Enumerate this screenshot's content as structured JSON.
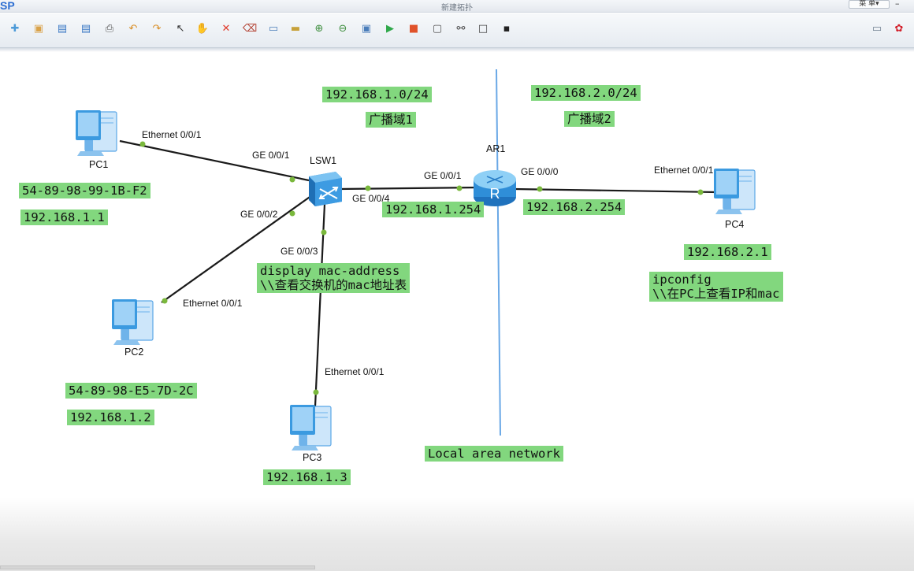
{
  "window": {
    "app_logo": "SP",
    "title": "新建拓扑",
    "menu_button": "菜 单▾",
    "minimize": "–"
  },
  "toolbar": {
    "buttons": [
      {
        "name": "new-topology-icon",
        "glyph": "✚",
        "color": "#4c9ad8"
      },
      {
        "name": "open-icon",
        "glyph": "▣",
        "color": "#d9a24a"
      },
      {
        "name": "save-icon",
        "glyph": "▤",
        "color": "#3a78c4"
      },
      {
        "name": "save-as-icon",
        "glyph": "▤",
        "color": "#3a78c4"
      },
      {
        "name": "print-icon",
        "glyph": "⎙",
        "color": "#555555"
      },
      {
        "name": "undo-icon",
        "glyph": "↶",
        "color": "#d9902a"
      },
      {
        "name": "redo-icon",
        "glyph": "↷",
        "color": "#d9902a"
      },
      {
        "name": "pointer-icon",
        "glyph": "↖",
        "color": "#333333"
      },
      {
        "name": "hand-icon",
        "glyph": "✋",
        "color": "#d49a3a"
      },
      {
        "name": "delete-icon",
        "glyph": "✕",
        "color": "#e03a2a"
      },
      {
        "name": "delete-link-icon",
        "glyph": "⌫",
        "color": "#b03a2a"
      },
      {
        "name": "text-note-icon",
        "glyph": "▭",
        "color": "#4a7dba"
      },
      {
        "name": "rectangle-icon",
        "glyph": "▬",
        "color": "#c7a13a"
      },
      {
        "name": "zoom-in-icon",
        "glyph": "⊕",
        "color": "#3f8f3f"
      },
      {
        "name": "zoom-out-icon",
        "glyph": "⊖",
        "color": "#3f8f3f"
      },
      {
        "name": "fit-view-icon",
        "glyph": "▣",
        "color": "#4a7dba"
      },
      {
        "name": "start-all-icon",
        "glyph": "▶",
        "color": "#2fa84a"
      },
      {
        "name": "stop-all-icon",
        "glyph": "■",
        "color": "#e0522a"
      },
      {
        "name": "capture-icon",
        "glyph": "▢",
        "color": "#555555"
      },
      {
        "name": "topology-icon",
        "glyph": "⚯",
        "color": "#444444"
      },
      {
        "name": "window-icon",
        "glyph": "□",
        "color": "#444444"
      },
      {
        "name": "terminal-icon",
        "glyph": "▪",
        "color": "#222222"
      }
    ],
    "right_buttons": [
      {
        "name": "chat-icon",
        "glyph": "▭",
        "color": "#6b7b8c"
      },
      {
        "name": "huawei-logo-icon",
        "glyph": "✿",
        "color": "#d21f2a"
      }
    ]
  },
  "devices": {
    "pc1": "PC1",
    "pc2": "PC2",
    "pc3": "PC3",
    "pc4": "PC4",
    "switch": "LSW1",
    "router": "AR1"
  },
  "ports": {
    "pc1_eth": "Ethernet 0/0/1",
    "sw_ge1": "GE 0/0/1",
    "sw_ge2": "GE 0/0/2",
    "sw_ge3": "GE 0/0/3",
    "sw_ge4": "GE 0/0/4",
    "pc2_eth": "Ethernet 0/0/1",
    "pc3_eth": "Ethernet 0/0/1",
    "ar_ge1": "GE 0/0/1",
    "ar_ge0": "GE 0/0/0",
    "pc4_eth": "Ethernet 0/0/1"
  },
  "notes": {
    "net1": "192.168.1.0/24",
    "bcast1": "广播域1",
    "net2": "192.168.2.0/24",
    "bcast2": "广播域2",
    "pc1_mac": "54-89-98-99-1B-F2",
    "pc1_ip": "192.168.1.1",
    "ar_ge1_ip": "192.168.1.254",
    "ar_ge0_ip": "192.168.2.254",
    "pc4_ip": "192.168.2.1",
    "cmd1_line1": "display mac-address",
    "cmd1_line2": "\\\\查看交换机的mac地址表",
    "cmd2_line1": "ipconfig",
    "cmd2_line2": "\\\\在PC上查看IP和mac",
    "pc2_mac": "54-89-98-E5-7D-2C",
    "pc2_ip": "192.168.1.2",
    "pc3_ip": "192.168.1.3",
    "lan": "Local area network"
  },
  "colors": {
    "note_bg": "#82d77e",
    "link": "#1a1a1a",
    "port_dot": "#7ab83c",
    "divider": "#6aa8e6",
    "device_blue": "#3b9ae0"
  }
}
